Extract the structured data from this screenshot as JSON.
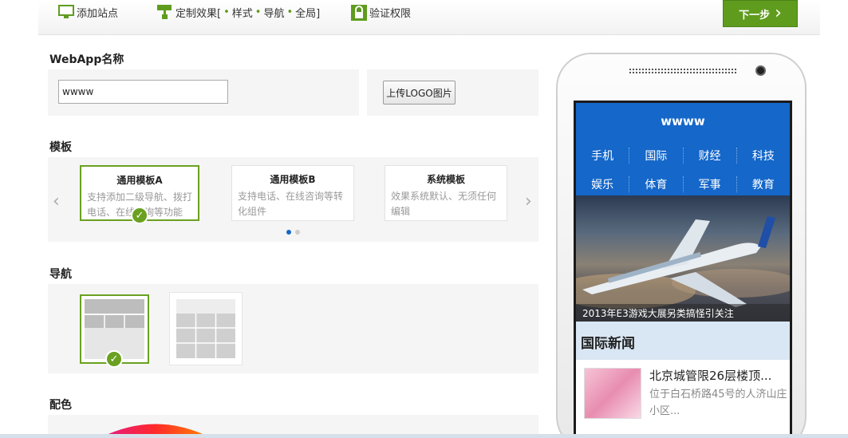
{
  "steps": {
    "step1": "添加站点",
    "step2": "定制效果[",
    "step2_items": [
      "样式",
      "导航",
      "全局]"
    ],
    "step3": "验证权限"
  },
  "next_button": {
    "label": "下一步"
  },
  "webapp_name": {
    "label": "WebApp名称",
    "value": "wwww",
    "upload_label": "上传LOGO图片"
  },
  "template": {
    "label": "模板",
    "cards": [
      {
        "title": "通用模板A",
        "desc": "支持添加二级导航、拨打电话、在线咨询等功能",
        "selected": true
      },
      {
        "title": "通用模板B",
        "desc": "支持电话、在线咨询等转化组件",
        "selected": false
      },
      {
        "title": "系统模板",
        "desc": "效果系统默认、无须任何编辑",
        "selected": false
      }
    ],
    "active_page": 1,
    "page_count": 2
  },
  "nav": {
    "label": "导航"
  },
  "color": {
    "label": "配色"
  },
  "preview": {
    "app_title": "wwww",
    "menu_row1": [
      "手机",
      "国际",
      "财经",
      "科技"
    ],
    "menu_row2": [
      "娱乐",
      "体育",
      "军事",
      "教育"
    ],
    "hero_caption": "2013年E3游戏大展另类搞怪引关注",
    "section_title": "国际新闻",
    "news": {
      "title": "北京城管限26层楼顶...",
      "desc": "位于白石桥路45号的人济山庄小区..."
    }
  },
  "colors": {
    "accent_green": "#6aa121",
    "brand_blue": "#1567c9"
  }
}
